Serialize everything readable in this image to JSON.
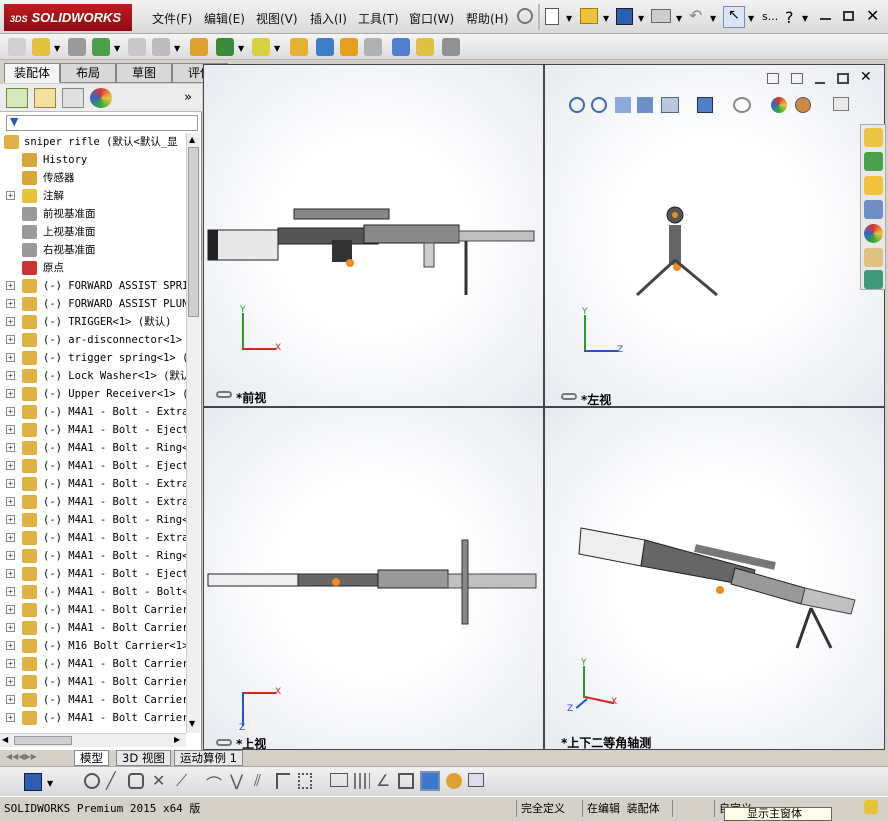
{
  "app": {
    "logo_text": "SOLIDWORKS",
    "ds_mark": "3DS"
  },
  "menu": [
    {
      "label": "文件(F)"
    },
    {
      "label": "编辑(E)"
    },
    {
      "label": "视图(V)"
    },
    {
      "label": "插入(I)"
    },
    {
      "label": "工具(T)"
    },
    {
      "label": "窗口(W)"
    },
    {
      "label": "帮助(H)"
    }
  ],
  "title_right": {
    "search_text": "s...",
    "help": "?"
  },
  "fm_tabs": [
    "装配体",
    "布局",
    "草图",
    "评估"
  ],
  "tree": {
    "root": "sniper rifle (默认<默认_显",
    "items": [
      {
        "label": "History",
        "expand": false,
        "icon": "history-icon",
        "color": "#d9a63a"
      },
      {
        "label": "传感器",
        "expand": false,
        "icon": "sensor-icon",
        "color": "#d9a63a"
      },
      {
        "label": "注解",
        "expand": true,
        "icon": "annotation-icon",
        "color": "#e6c23a"
      },
      {
        "label": "前视基准面",
        "expand": false,
        "icon": "plane-icon",
        "color": "#999999"
      },
      {
        "label": "上视基准面",
        "expand": false,
        "icon": "plane-icon",
        "color": "#999999"
      },
      {
        "label": "右视基准面",
        "expand": false,
        "icon": "plane-icon",
        "color": "#999999"
      },
      {
        "label": "原点",
        "expand": false,
        "icon": "origin-icon",
        "color": "#cc3333"
      },
      {
        "label": "(-) FORWARD ASSIST SPRIN",
        "expand": true,
        "icon": "part-icon",
        "color": "#e0b040"
      },
      {
        "label": "(-) FORWARD ASSIST PLUNG",
        "expand": true,
        "icon": "part-icon",
        "color": "#e0b040"
      },
      {
        "label": "(-) TRIGGER<1> (默认)",
        "expand": true,
        "icon": "part-icon",
        "color": "#e0b040"
      },
      {
        "label": "(-) ar-disconnector<1> (",
        "expand": true,
        "icon": "part-icon",
        "color": "#e0b040"
      },
      {
        "label": "(-) trigger spring<1> (",
        "expand": true,
        "icon": "part-icon",
        "color": "#e0b040"
      },
      {
        "label": "(-) Lock Washer<1> (默认",
        "expand": true,
        "icon": "part-icon",
        "color": "#e0b040"
      },
      {
        "label": "(-) Upper Receiver<1> (",
        "expand": true,
        "icon": "part-icon",
        "color": "#e0b040"
      },
      {
        "label": "(-) M4A1 - Bolt - Extrac",
        "expand": true,
        "icon": "part-icon",
        "color": "#e0b040"
      },
      {
        "label": "(-) M4A1 - Bolt - Ejecto",
        "expand": true,
        "icon": "part-icon",
        "color": "#e0b040"
      },
      {
        "label": "(-) M4A1 - Bolt - Ring<1",
        "expand": true,
        "icon": "part-icon",
        "color": "#e0b040"
      },
      {
        "label": "(-) M4A1 - Bolt - Ejecto",
        "expand": true,
        "icon": "part-icon",
        "color": "#e0b040"
      },
      {
        "label": "(-) M4A1 - Bolt - Extrac",
        "expand": true,
        "icon": "part-icon",
        "color": "#e0b040"
      },
      {
        "label": "(-) M4A1 - Bolt - Extrac",
        "expand": true,
        "icon": "part-icon",
        "color": "#e0b040"
      },
      {
        "label": "(-) M4A1 - Bolt - Ring<2",
        "expand": true,
        "icon": "part-icon",
        "color": "#e0b040"
      },
      {
        "label": "(-) M4A1 - Bolt - Extrac",
        "expand": true,
        "icon": "part-icon",
        "color": "#e0b040"
      },
      {
        "label": "(-) M4A1 - Bolt - Ring<3",
        "expand": true,
        "icon": "part-icon",
        "color": "#e0b040"
      },
      {
        "label": "(-) M4A1 - Bolt - Ejecto",
        "expand": true,
        "icon": "part-icon",
        "color": "#e0b040"
      },
      {
        "label": "(-) M4A1 - Bolt - Bolt<1",
        "expand": true,
        "icon": "part-icon",
        "color": "#e0b040"
      },
      {
        "label": "(-) M4A1 - Bolt Carrier-",
        "expand": true,
        "icon": "part-icon",
        "color": "#e0b040"
      },
      {
        "label": "(-) M4A1 - Bolt Carrier",
        "expand": true,
        "icon": "part-icon",
        "color": "#e0b040"
      },
      {
        "label": "(-) M16 Bolt Carrier<1>",
        "expand": true,
        "icon": "part-icon",
        "color": "#e0b040"
      },
      {
        "label": "(-) M4A1 - Bolt Carrier",
        "expand": true,
        "icon": "part-icon",
        "color": "#e0b040"
      },
      {
        "label": "(-) M4A1 - Bolt Carrier",
        "expand": true,
        "icon": "part-icon",
        "color": "#e0b040"
      },
      {
        "label": "(-) M4A1 - Bolt Carrier",
        "expand": true,
        "icon": "part-icon",
        "color": "#e0b040"
      },
      {
        "label": "(-) M4A1 - Bolt Carrier",
        "expand": true,
        "icon": "part-icon",
        "color": "#e0b040"
      }
    ]
  },
  "viewports": [
    {
      "label": "*前视",
      "axes": [
        "Y",
        "X"
      ]
    },
    {
      "label": "*左视",
      "axes": [
        "Y",
        "Z"
      ]
    },
    {
      "label": "*上视",
      "axes": [
        "X",
        "Z"
      ]
    },
    {
      "label": "*上下二等角轴测",
      "axes": [
        "Y",
        "X",
        "Z"
      ]
    }
  ],
  "bottom_tabs": [
    "模型",
    "3D 视图",
    "运动算例 1"
  ],
  "status": {
    "version": "SOLIDWORKS Premium 2015 x64 版",
    "state": "完全定义",
    "mode": "在编辑 装配体",
    "custom": "自定义",
    "popup": "显示主窗体"
  },
  "colors": {
    "brand_red": "#b8141c",
    "accent_blue": "#1a5fb4"
  }
}
